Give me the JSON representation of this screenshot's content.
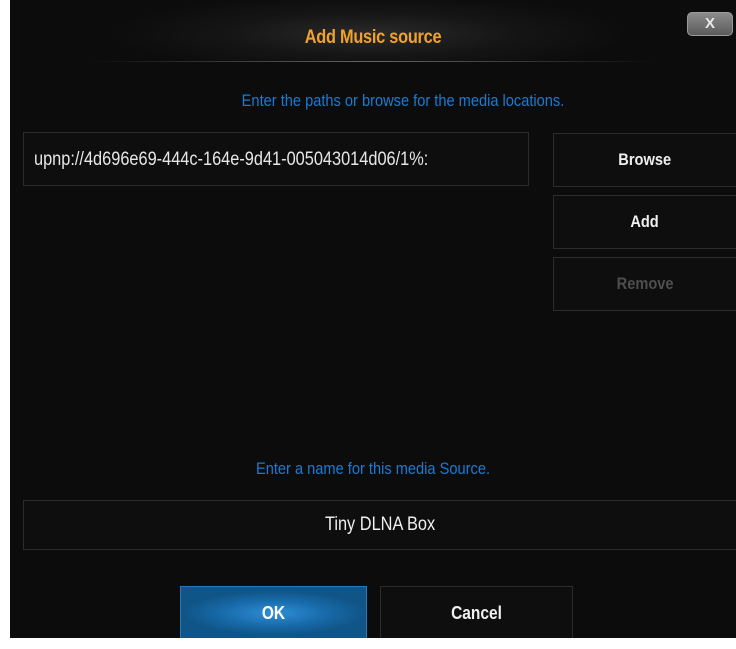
{
  "dialog": {
    "title": "Add Music source",
    "close_label": "X",
    "paths_hint": "Enter the paths or browse for the media locations.",
    "path_value": "upnp://4d696e69-444c-164e-9d41-005043014d06/1%:",
    "buttons": {
      "browse": "Browse",
      "add": "Add",
      "remove": "Remove"
    },
    "name_hint": "Enter a name for this media Source.",
    "name_value": "Tiny DLNA Box",
    "ok_label": "OK",
    "cancel_label": "Cancel"
  },
  "colors": {
    "title": "#f0a22a",
    "hint": "#1a7bd6",
    "ok_button": "#1769a8",
    "disabled_text": "#4e4e4e"
  }
}
